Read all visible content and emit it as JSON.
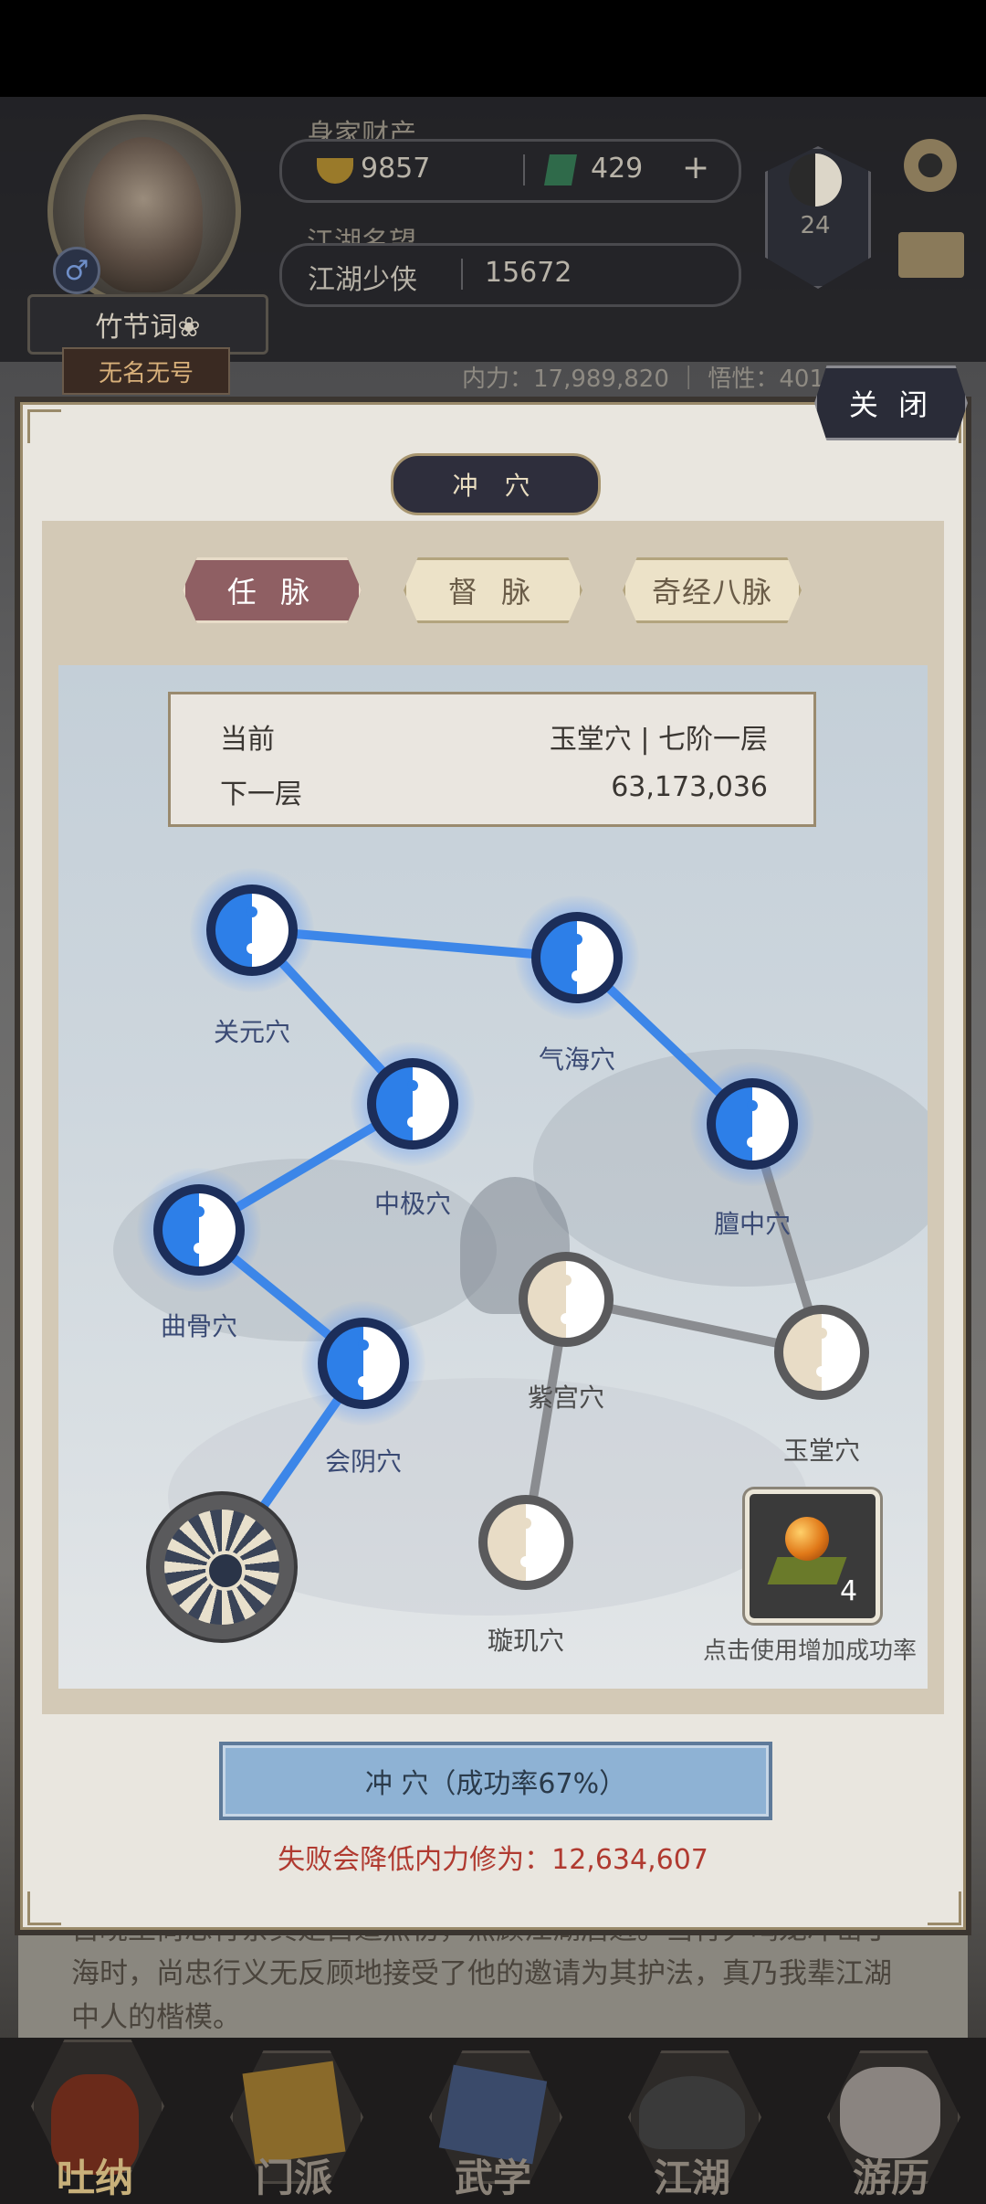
{
  "player": {
    "name": "竹节词❀",
    "title": "无名无号",
    "gender_icon": "male-symbol",
    "wealth_label": "身家财产",
    "gold": "9857",
    "jade": "429",
    "fame_label": "江湖名望",
    "rank": "江湖少侠",
    "fame": "15672",
    "level": "24",
    "stats": "内力：17,989,820 ｜ 悟性：401"
  },
  "modal": {
    "close_label": "关 闭",
    "title": "冲 穴",
    "tabs": [
      {
        "label": "任 脉",
        "active": true
      },
      {
        "label": "督 脉",
        "active": false
      },
      {
        "label": "奇经八脉",
        "active": false
      }
    ],
    "info": {
      "current_label": "当前",
      "current_value": "玉堂穴 | 七阶一层",
      "next_label": "下一层",
      "next_value": "63,173,036"
    },
    "points": [
      {
        "label": "关元穴",
        "state": "open"
      },
      {
        "label": "气海穴",
        "state": "open"
      },
      {
        "label": "中极穴",
        "state": "open"
      },
      {
        "label": "膻中穴",
        "state": "open"
      },
      {
        "label": "曲骨穴",
        "state": "open"
      },
      {
        "label": "紫宫穴",
        "state": "locked"
      },
      {
        "label": "会阴穴",
        "state": "open"
      },
      {
        "label": "玉堂穴",
        "state": "locked"
      },
      {
        "label": "璇玑穴",
        "state": "locked"
      }
    ],
    "item": {
      "count": "4",
      "caption": "点击使用增加成功率"
    },
    "breach_button": "冲 穴（成功率67%）",
    "fail_warning": "失败会降低内力修为：12,634,607"
  },
  "story": {
    "line1": "自晓王尚忠行亲其是白道照初，照顾江湖后进。当行尹鸣龙冲击丁",
    "line2": "海时，尚忠行义无反顾地接受了他的邀请为其护法，真乃我辈江湖",
    "line3": "中人的楷模。"
  },
  "nav": [
    {
      "label": "吐纳",
      "icon": "gourd-icon"
    },
    {
      "label": "门派",
      "icon": "banner-icon"
    },
    {
      "label": "武学",
      "icon": "books-icon"
    },
    {
      "label": "江湖",
      "icon": "hat-icon"
    },
    {
      "label": "游历",
      "icon": "horse-icon"
    }
  ],
  "colors": {
    "open_point": "#2d7fe8",
    "locked_point": "#e8dcc6",
    "active_tab": "#8f5f63",
    "warning": "#b03a30"
  }
}
